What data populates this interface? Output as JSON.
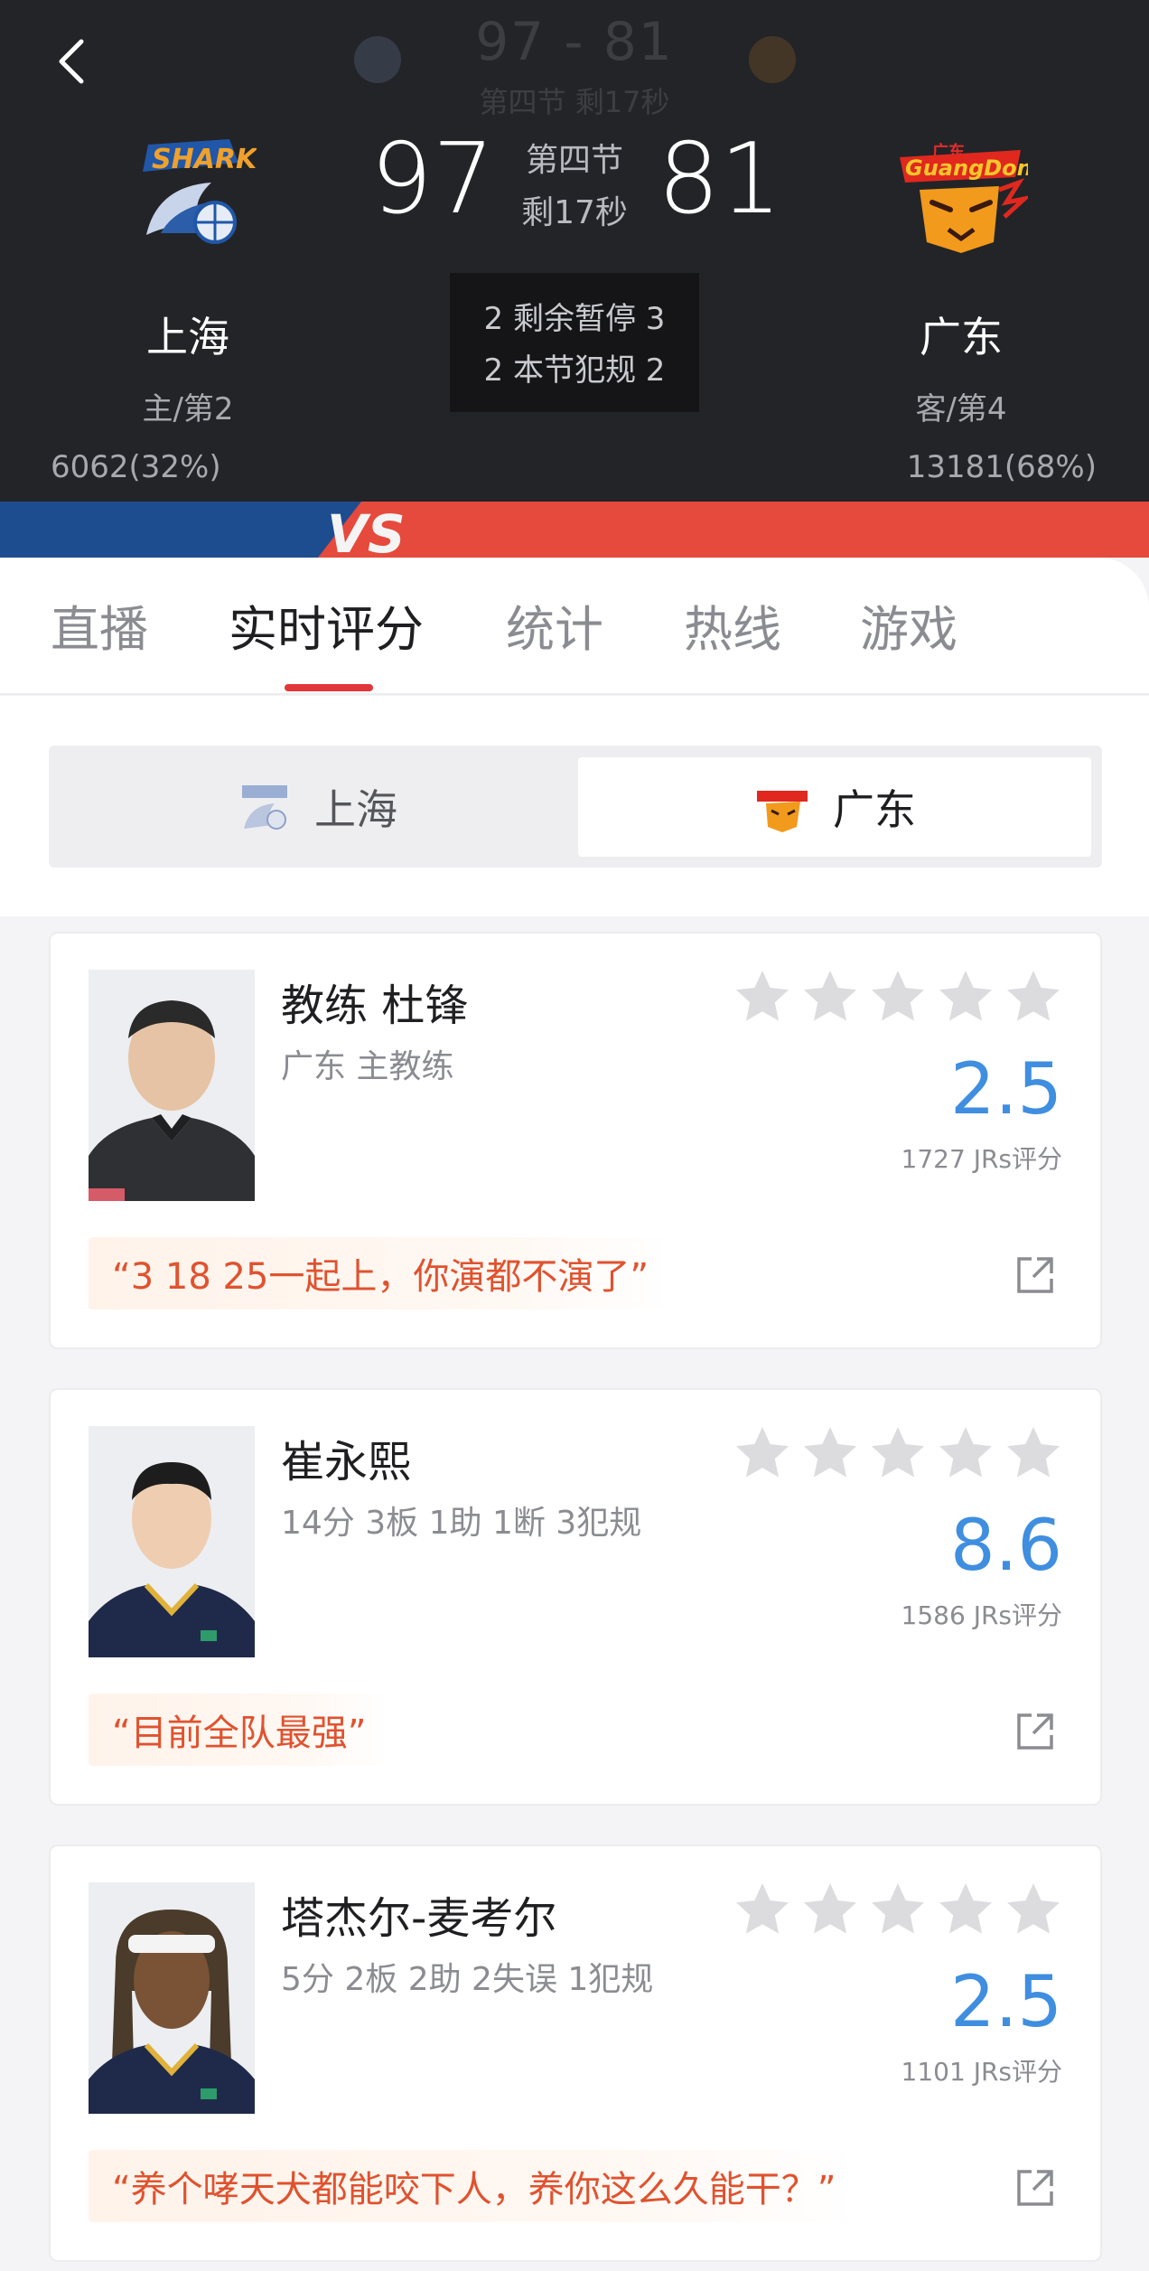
{
  "header": {
    "ghost_score": "97 - 81",
    "ghost_period": "第四节 剩17秒",
    "home": {
      "name": "上海",
      "meta": "主/第2",
      "pct": "6062(32%)",
      "score": "97"
    },
    "away": {
      "name": "广东",
      "meta": "客/第4",
      "pct": "13181(68%)",
      "score": "81"
    },
    "period_line1": "第四节",
    "period_line2": "剩17秒",
    "timeouts": "2 剩余暂停 3",
    "fouls": "2 本节犯规 2",
    "vs": "VS",
    "colors": {
      "home_side": "#1e4d8f",
      "away_side": "#e64a3c"
    }
  },
  "tabs": [
    {
      "label": "直播"
    },
    {
      "label": "实时评分",
      "active": true
    },
    {
      "label": "统计"
    },
    {
      "label": "热线"
    },
    {
      "label": "游戏"
    }
  ],
  "team_toggle": {
    "left": "上海",
    "right": "广东",
    "selected": "广东"
  },
  "cards": [
    {
      "name": "教练 杜锋",
      "stats": "广东 主教练",
      "rating": "2.5",
      "count": "1727 JRs评分",
      "quote": "“3 18 25一起上，你演都不演了”"
    },
    {
      "name": "崔永熙",
      "stats": "14分 3板 1助 1断 3犯规",
      "rating": "8.6",
      "count": "1586 JRs评分",
      "quote": "“目前全队最强”"
    },
    {
      "name": "塔杰尔-麦考尔",
      "stats": "5分 2板 2助 2失误 1犯规",
      "rating": "2.5",
      "count": "1101 JRs评分",
      "quote": "“养个哮天犬都能咬下人，养你这么久能干？”"
    }
  ],
  "icons": {
    "back": "chevron-left-icon",
    "star": "star-icon",
    "share": "share-icon"
  },
  "accent": "#e1373a",
  "rating_color": "#3f8ee0",
  "quote_color": "#e0522f"
}
